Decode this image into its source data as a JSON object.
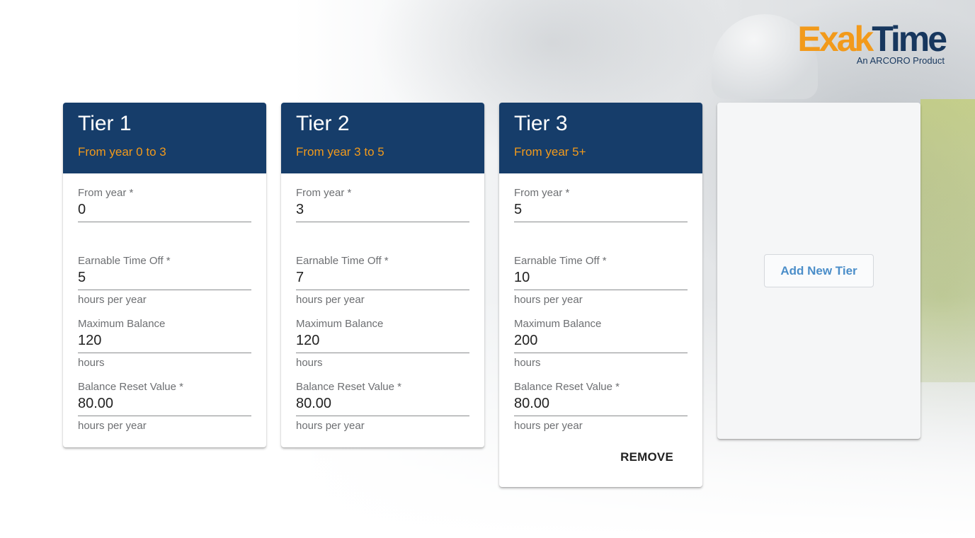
{
  "brand": {
    "logo_exak": "Exak",
    "logo_time": "Time",
    "logo_sub": "An ARCORO Product"
  },
  "tiers": [
    {
      "title": "Tier 1",
      "range": "From year 0 to 3",
      "from_year_label": "From year *",
      "from_year_value": "0",
      "earnable_label": "Earnable Time Off *",
      "earnable_value": "5",
      "earnable_helper": "hours per year",
      "max_balance_label": "Maximum Balance",
      "max_balance_value": "120",
      "max_balance_helper": "hours",
      "reset_label": "Balance Reset Value *",
      "reset_value": "80.00",
      "reset_helper": "hours per year"
    },
    {
      "title": "Tier 2",
      "range": "From year 3 to 5",
      "from_year_label": "From year *",
      "from_year_value": "3",
      "earnable_label": "Earnable Time Off *",
      "earnable_value": "7",
      "earnable_helper": "hours per year",
      "max_balance_label": "Maximum Balance",
      "max_balance_value": "120",
      "max_balance_helper": "hours",
      "reset_label": "Balance Reset Value *",
      "reset_value": "80.00",
      "reset_helper": "hours per year"
    },
    {
      "title": "Tier 3",
      "range": "From year 5+",
      "from_year_label": "From year *",
      "from_year_value": "5",
      "earnable_label": "Earnable Time Off *",
      "earnable_value": "10",
      "earnable_helper": "hours per year",
      "max_balance_label": "Maximum Balance",
      "max_balance_value": "200",
      "max_balance_helper": "hours",
      "reset_label": "Balance Reset Value *",
      "reset_value": "80.00",
      "reset_helper": "hours per year",
      "remove_label": "REMOVE"
    }
  ],
  "add_tier_label": "Add New Tier",
  "colors": {
    "header_navy": "#163d6a",
    "accent_orange": "#f29a1b",
    "link_blue": "#4b8ec9"
  }
}
